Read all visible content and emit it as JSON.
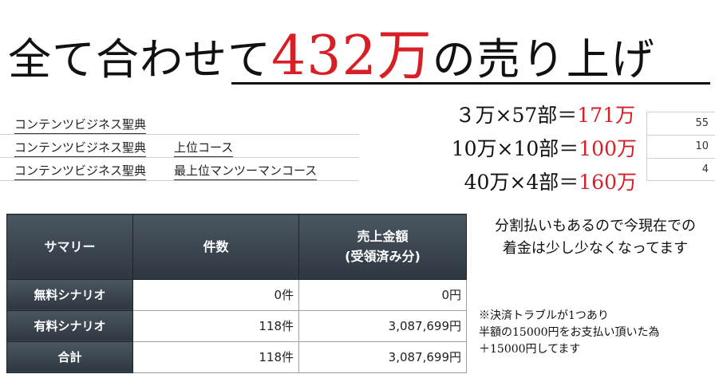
{
  "headline": {
    "prefix": "全て合わせて",
    "amount": "432万",
    "suffix": "の売り上げ"
  },
  "products": [
    {
      "name": "コンテンツビジネス聖典",
      "course": ""
    },
    {
      "name": "コンテンツビジネス聖典",
      "course": "上位コース"
    },
    {
      "name": "コンテンツビジネス聖典",
      "course": "最上位マンツーマンコース"
    }
  ],
  "calculations": [
    {
      "expr": "３万×57部＝",
      "result": "171万"
    },
    {
      "expr": "10万×10部＝",
      "result": "100万"
    },
    {
      "expr": "40万×4部＝",
      "result": "160万"
    }
  ],
  "counts": [
    "55",
    "10",
    "4"
  ],
  "summary": {
    "headers": [
      "サマリー",
      "件数",
      "売上金額",
      "(受領済み分)"
    ],
    "rows": [
      {
        "label": "無料シナリオ",
        "count": "0件",
        "amount": "0円"
      },
      {
        "label": "有料シナリオ",
        "count": "118件",
        "amount": "3,087,699円"
      },
      {
        "label": "合計",
        "count": "118件",
        "amount": "3,087,699円"
      }
    ]
  },
  "notes": {
    "installment_line1": "分割払いもあるので今現在での",
    "installment_line2": "着金は少し少なくなってます",
    "trouble_line1": "※決済トラブルが1つあり",
    "trouble_line2": "半額の15000円をお支払い頂いた為",
    "trouble_line3": "＋15000円してます"
  },
  "colors": {
    "accent": "#d91f26",
    "table_header": "#3a4550"
  }
}
